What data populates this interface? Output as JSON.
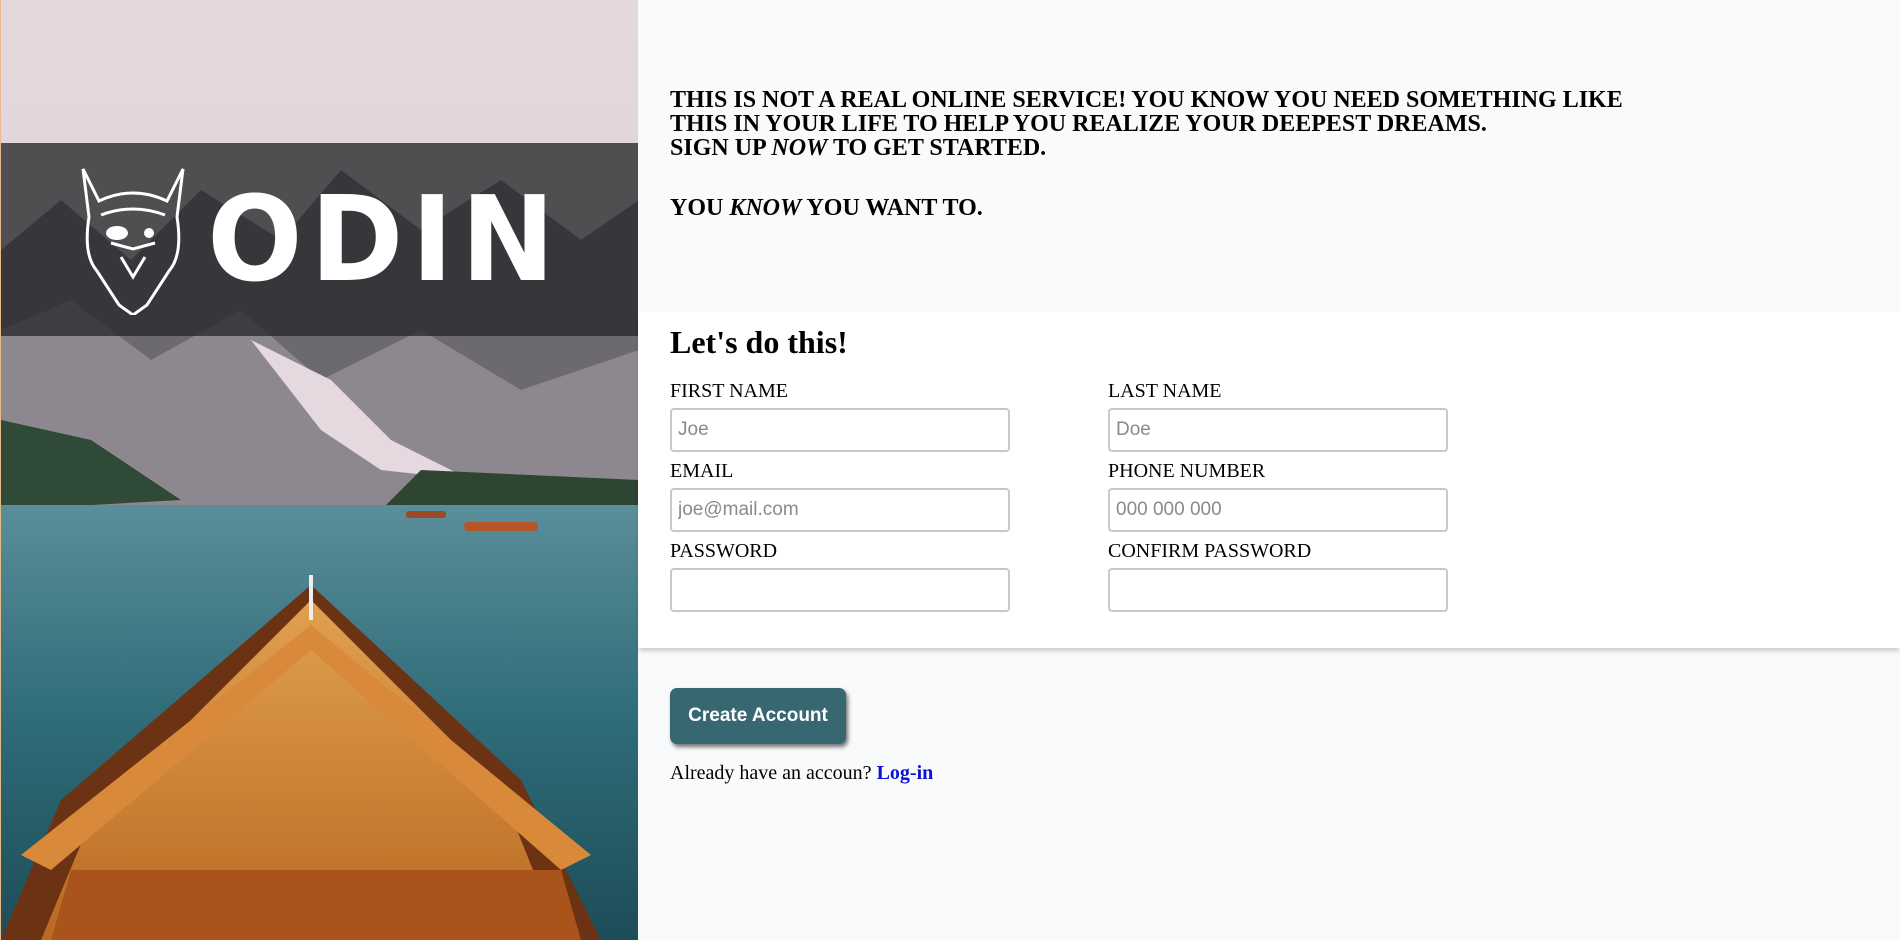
{
  "hero": {
    "brand_name": "ODIN",
    "logo_icon": "viking-helmet-icon"
  },
  "intro": {
    "pitch_line_1": "THIS IS NOT A REAL ONLINE SERVICE! YOU KNOW YOU NEED SOMETHING LIKE",
    "pitch_line_2": "THIS IN YOUR LIFE TO HELP YOU REALIZE YOUR DEEPEST DREAMS.",
    "pitch_line_3_pre": "SIGN UP ",
    "pitch_line_3_em": "NOW",
    "pitch_line_3_post": " TO GET STARTED.",
    "tagline_pre": "YOU ",
    "tagline_em": "KNOW",
    "tagline_post": " YOU WANT TO."
  },
  "form": {
    "heading": "Let's do this!",
    "first_name": {
      "label": "FIRST NAME",
      "placeholder": "Joe"
    },
    "last_name": {
      "label": "LAST NAME",
      "placeholder": "Doe"
    },
    "email": {
      "label": "EMAIL",
      "placeholder": "joe@mail.com"
    },
    "phone": {
      "label": "PHONE NUMBER",
      "placeholder": "000 000 000"
    },
    "password": {
      "label": "PASSWORD",
      "placeholder": ""
    },
    "confirm_password": {
      "label": "CONFIRM PASSWORD",
      "placeholder": ""
    }
  },
  "actions": {
    "create_account_label": "Create Account",
    "login_prompt": "Already have an accoun?",
    "login_link": "Log-in"
  },
  "colors": {
    "button": "#376771",
    "link": "#0a12d6",
    "page_bg": "#f9fafb"
  }
}
